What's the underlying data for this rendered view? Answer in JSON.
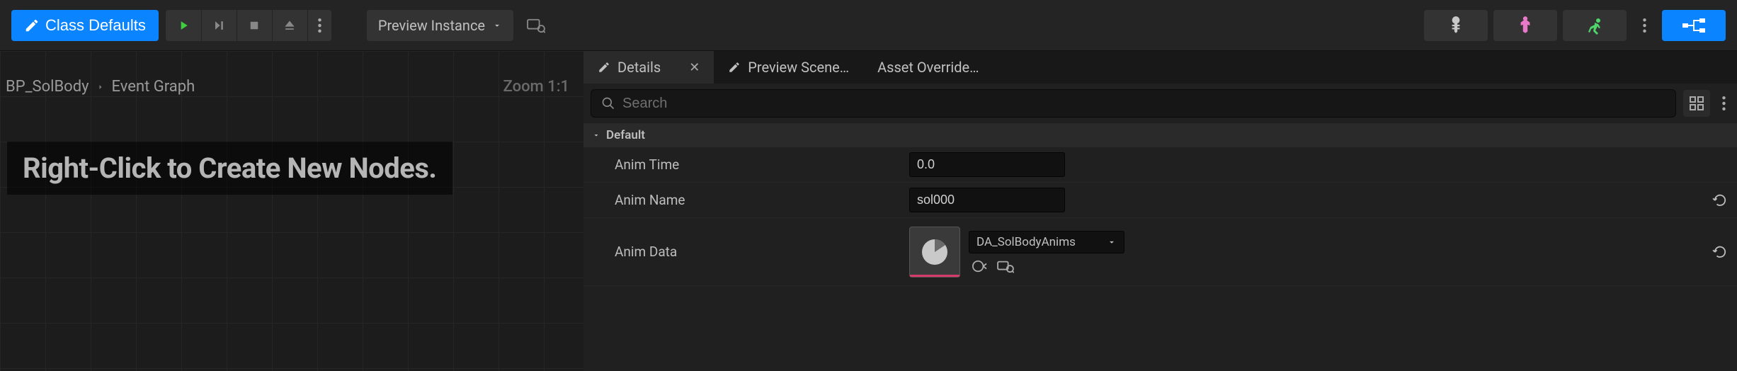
{
  "toolbar": {
    "class_defaults_label": "Class Defaults",
    "preview_instance_label": "Preview Instance"
  },
  "graph": {
    "breadcrumb_root": "BP_SolBody",
    "breadcrumb_leaf": "Event Graph",
    "zoom_label": "Zoom 1:1",
    "hint_text": "Right-Click to Create New Nodes."
  },
  "tabs": {
    "details": "Details",
    "preview_scene": "Preview Scene…",
    "asset_override": "Asset Override…"
  },
  "search": {
    "placeholder": "Search"
  },
  "category": {
    "default": "Default"
  },
  "props": {
    "anim_time": {
      "label": "Anim Time",
      "value": "0.0"
    },
    "anim_name": {
      "label": "Anim Name",
      "value": "sol000"
    },
    "anim_data": {
      "label": "Anim Data",
      "value": "DA_SolBodyAnims"
    }
  },
  "colors": {
    "accent": "#0a84ff"
  }
}
